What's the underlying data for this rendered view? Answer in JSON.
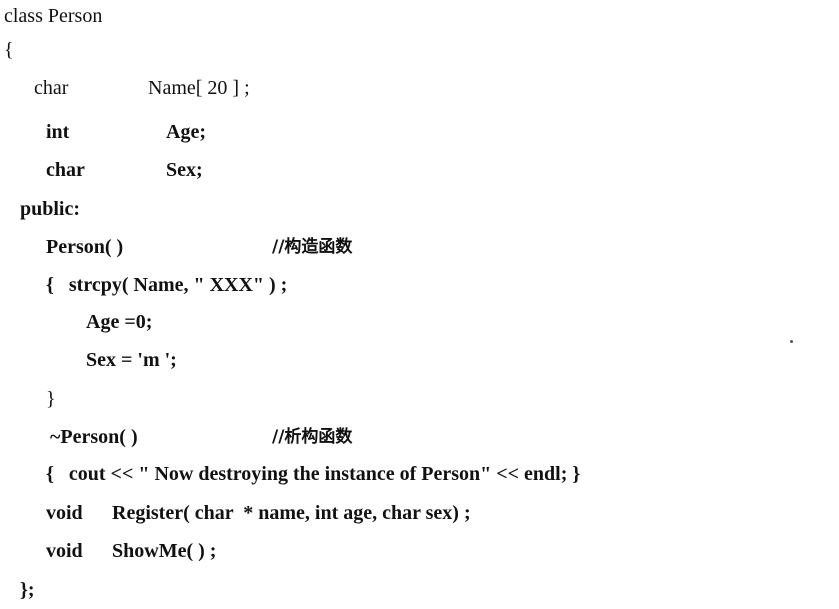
{
  "code": {
    "l1": "class Person",
    "l2": "{",
    "l3a": "char",
    "l3b": "Name[ 20 ] ;",
    "l4a": "int",
    "l4b": "Age;",
    "l5a": "char",
    "l5b": "Sex;",
    "l6": "public:",
    "l7a": "Person( )",
    "l7c": "//构造函数",
    "l8": "{   strcpy( Name, \" XXX\" ) ;",
    "l9": "Age =0;",
    "l10": "Sex = 'm ';",
    "l11": "}",
    "l12a": "~Person( )",
    "l12c": "//析构函数",
    "l13": "{   cout << \" Now destroying the instance of Person\" << endl; }",
    "l14a": "void",
    "l14b": "Register( char  * name, int age, char sex) ;",
    "l15a": "void",
    "l15b": "ShowMe( ) ;",
    "l16": "};"
  }
}
